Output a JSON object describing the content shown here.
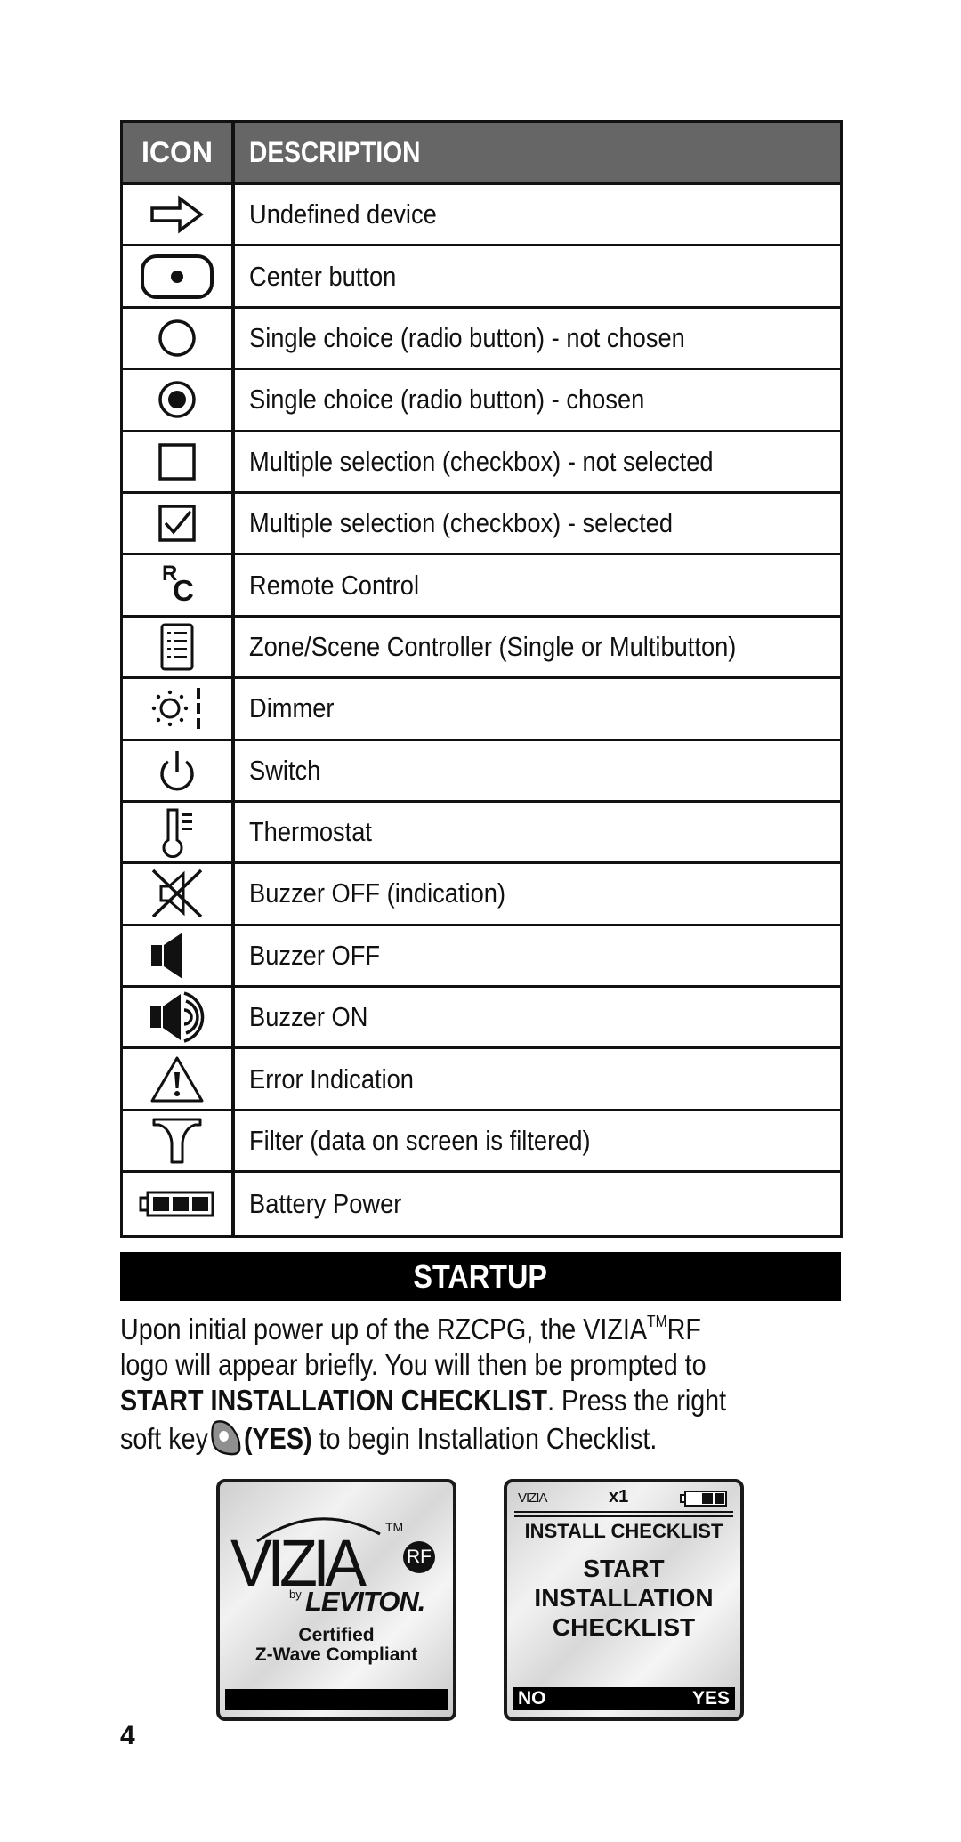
{
  "table": {
    "headers": {
      "icon": "ICON",
      "description": "DESCRIPTION"
    },
    "header_bg": "#666666",
    "rows": [
      {
        "icon": "arrow-right-outline-icon",
        "description": "Undefined device"
      },
      {
        "icon": "center-button-icon",
        "description": "Center button"
      },
      {
        "icon": "radio-unchecked-icon",
        "description": "Single choice (radio button) - not chosen"
      },
      {
        "icon": "radio-checked-icon",
        "description": "Single choice (radio button) - chosen"
      },
      {
        "icon": "checkbox-unchecked-icon",
        "description": "Multiple selection (checkbox) - not selected"
      },
      {
        "icon": "checkbox-checked-icon",
        "description": "Multiple selection (checkbox) - selected"
      },
      {
        "icon": "remote-control-icon",
        "description": "Remote Control"
      },
      {
        "icon": "scene-controller-icon",
        "description": "Zone/Scene Controller (Single or Multibutton)"
      },
      {
        "icon": "dimmer-icon",
        "description": "Dimmer"
      },
      {
        "icon": "power-switch-icon",
        "description": "Switch"
      },
      {
        "icon": "thermostat-icon",
        "description": "Thermostat"
      },
      {
        "icon": "speaker-crossed-icon",
        "description": "Buzzer OFF (indication)"
      },
      {
        "icon": "speaker-icon",
        "description": "Buzzer OFF"
      },
      {
        "icon": "speaker-sound-icon",
        "description": "Buzzer ON"
      },
      {
        "icon": "warning-triangle-icon",
        "description": "Error Indication"
      },
      {
        "icon": "filter-funnel-icon",
        "description": "Filter (data on screen is filtered)"
      },
      {
        "icon": "battery-full-icon",
        "description": "Battery Power"
      }
    ],
    "rc_glyph": {
      "top": "R",
      "bottom": "C"
    }
  },
  "startup": {
    "title": "STARTUP",
    "line1_a": "Upon initial power up of the RZCPG, the VIZIA",
    "line1_tm": "TM",
    "line1_b": "RF",
    "line2": "logo will appear briefly. You will then be prompted to",
    "line3_bold": "START INSTALLATION CHECKLIST",
    "line3_rest": ". Press the right",
    "line4_a": "soft key",
    "line4_bold": "(YES)",
    "line4_b": " to begin Installation Checklist."
  },
  "logo_screen": {
    "brand": "VIZIA",
    "tm": "TM",
    "rf_badge": "RF",
    "by": "by",
    "maker": "LEVITON.",
    "cert_line1": "Certified",
    "cert_line2": "Z-Wave Compliant"
  },
  "checklist_screen": {
    "mini_logo": "VIZIA",
    "count": "x1",
    "battery_level": "2/3",
    "heading": "INSTALL CHECKLIST",
    "prompt_lines": [
      "START",
      "INSTALLATION",
      "CHECKLIST"
    ],
    "softkey_left": "NO",
    "softkey_right": "YES"
  },
  "page_number": "4"
}
